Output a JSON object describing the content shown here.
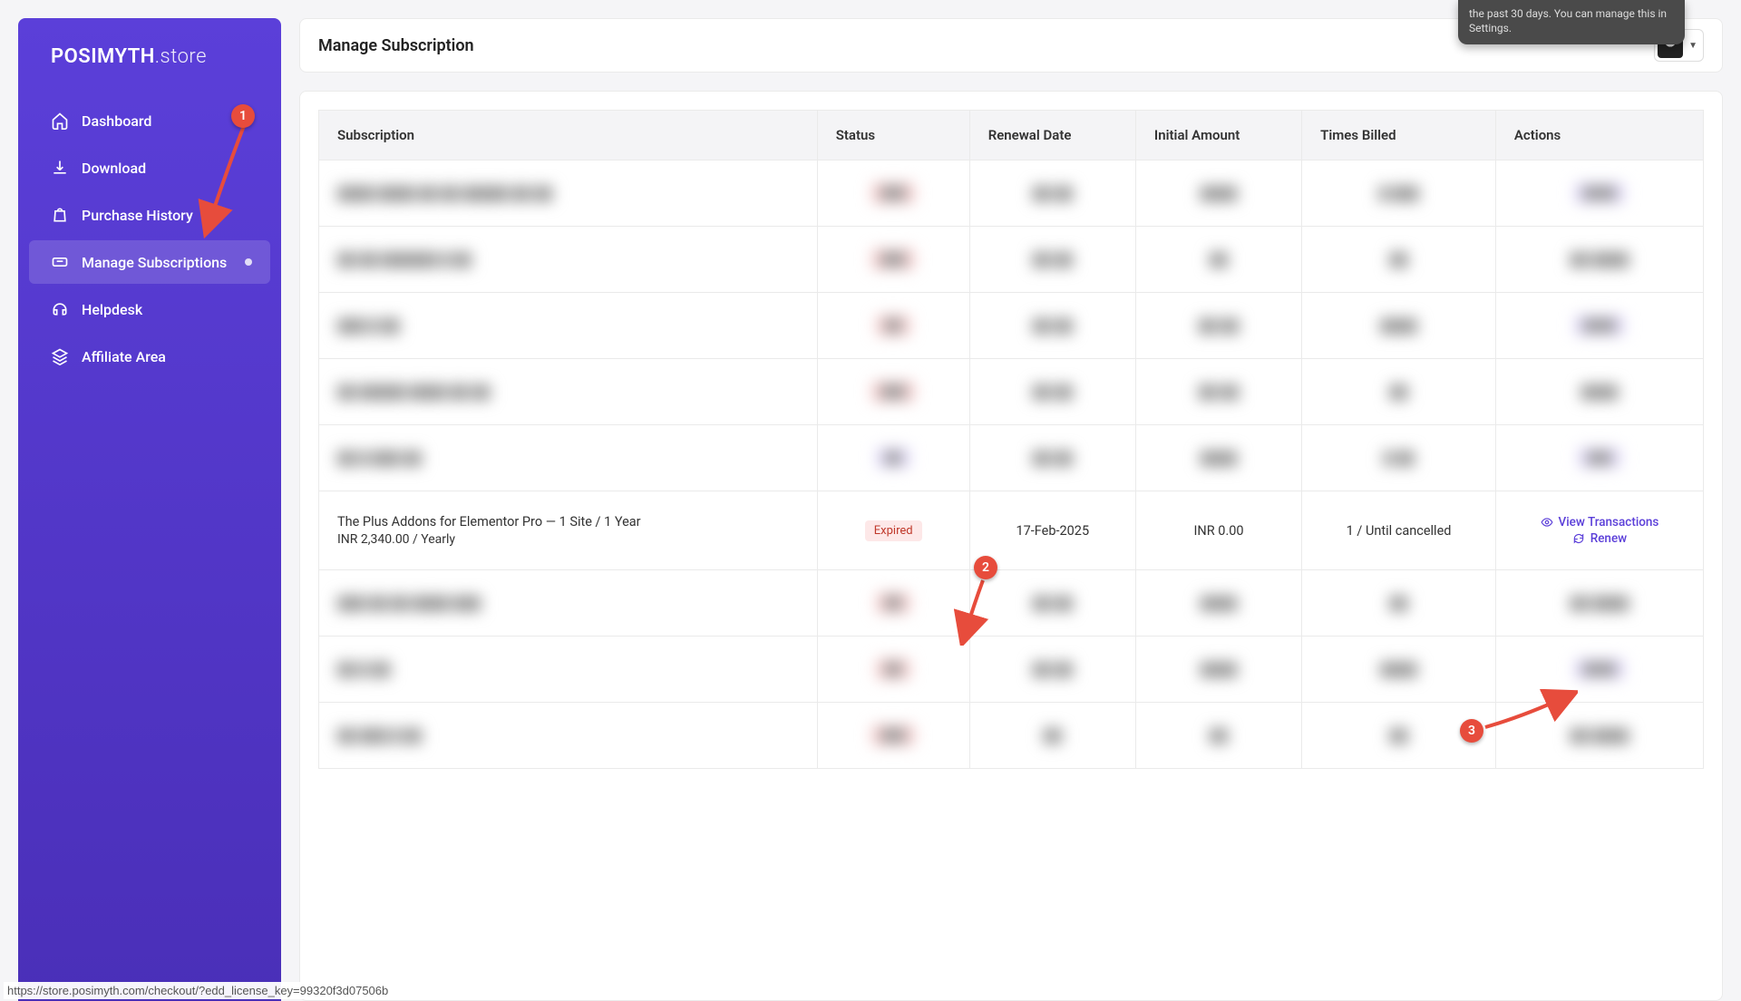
{
  "brand": {
    "part1": "POSIMYTH",
    "part2": ".store"
  },
  "sidebar": {
    "items": [
      {
        "label": "Dashboard"
      },
      {
        "label": "Download"
      },
      {
        "label": "Purchase History"
      },
      {
        "label": "Manage Subscriptions"
      },
      {
        "label": "Helpdesk"
      },
      {
        "label": "Affiliate Area"
      }
    ]
  },
  "header": {
    "title": "Manage Subscription"
  },
  "table": {
    "headers": {
      "subscription": "Subscription",
      "status": "Status",
      "renewal": "Renewal Date",
      "initial": "Initial Amount",
      "billed": "Times Billed",
      "actions": "Actions"
    }
  },
  "row_clear": {
    "name_l1": "The Plus Addons for Elementor Pro — 1 Site / 1 Year",
    "name_l2": "INR 2,340.00 / Yearly",
    "status": "Expired",
    "renewal": "17-Feb-2025",
    "initial": "INR 0.00",
    "billed": "1 / Until cancelled",
    "view": "View Transactions",
    "renew": "Renew"
  },
  "markers": {
    "m1": "1",
    "m2": "2",
    "m3": "3"
  },
  "toast": "the past 30 days. You can manage this in Settings.",
  "status_url": "https://store.posimyth.com/checkout/?edd_license_key=99320f3d07506b"
}
